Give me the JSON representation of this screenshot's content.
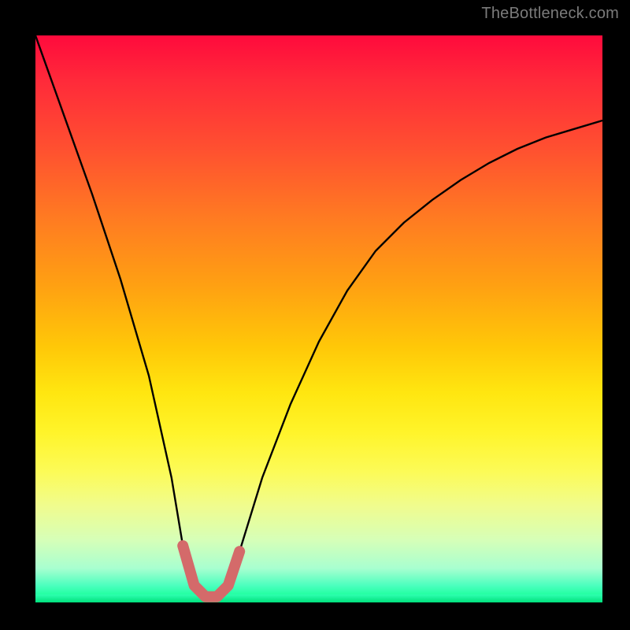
{
  "watermark": "TheBottleneck.com",
  "colors": {
    "background": "#000000",
    "curve": "#000000",
    "bottom_marker": "#d46a6a",
    "gradient_top": "#ff0a3c",
    "gradient_mid1": "#ff7a22",
    "gradient_mid2": "#ffe610",
    "gradient_bottom": "#00ff88"
  },
  "chart_data": {
    "type": "line",
    "title": "",
    "xlabel": "",
    "ylabel": "",
    "xlim": [
      0,
      100
    ],
    "ylim": [
      0,
      100
    ],
    "grid": false,
    "series": [
      {
        "name": "bottleneck-curve",
        "x": [
          0,
          5,
          10,
          15,
          20,
          24,
          26,
          28,
          30,
          32,
          34,
          36,
          40,
          45,
          50,
          55,
          60,
          65,
          70,
          75,
          80,
          85,
          90,
          95,
          100
        ],
        "y": [
          100,
          86,
          72,
          57,
          40,
          22,
          10,
          3,
          1,
          1,
          3,
          9,
          22,
          35,
          46,
          55,
          62,
          67,
          71,
          74.5,
          77.5,
          80,
          82,
          83.5,
          85
        ]
      }
    ],
    "annotations": [
      {
        "name": "minimum-band",
        "x_range": [
          26,
          36
        ],
        "style": "thick-rounded",
        "color": "#d46a6a"
      }
    ]
  }
}
